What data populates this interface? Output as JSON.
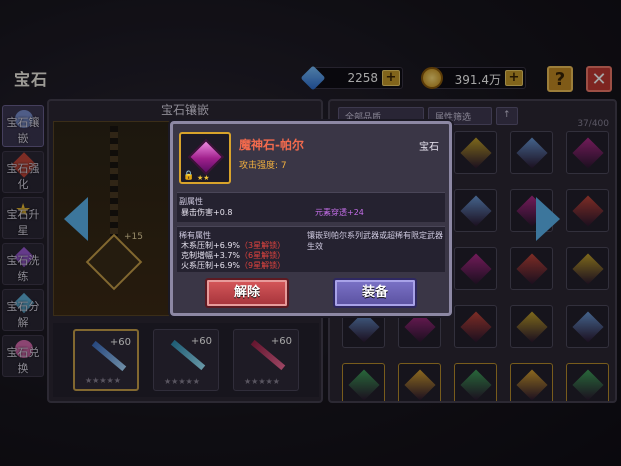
{
  "page_title": "宝石",
  "resources": {
    "diamonds": {
      "value": "2258",
      "icon": "diamond-icon",
      "color": "#3e8be6"
    },
    "gold": {
      "value": "391.4万",
      "icon": "gold-coin-icon",
      "color": "#e6b434"
    }
  },
  "top_buttons": {
    "help": "?",
    "close": "✕"
  },
  "tabs": [
    {
      "label": "宝石镶嵌",
      "active": true
    },
    {
      "label": "宝石强化",
      "active": false
    },
    {
      "label": "宝石升星",
      "active": false
    },
    {
      "label": "宝石洗练",
      "active": false
    },
    {
      "label": "宝石分解",
      "active": false
    },
    {
      "label": "宝石兑换",
      "active": false
    }
  ],
  "left_panel": {
    "header": "宝石镶嵌",
    "forge_level": "+15",
    "slots": [
      {
        "level": "+60",
        "selected": true
      },
      {
        "level": "+60",
        "selected": false
      },
      {
        "level": "+60",
        "selected": false
      }
    ]
  },
  "right_panel": {
    "filters": [
      "全部品质",
      "属性筛选",
      "↑"
    ],
    "capacity": "37/400"
  },
  "modal": {
    "name": "魔神石-帕尔",
    "type": "宝石",
    "attack_label": "攻击强度: 7",
    "secondary": {
      "heading": "副属性",
      "crit": "暴击伤害+0.8",
      "element": "元素穿透+24"
    },
    "rare": {
      "heading": "稀有属性",
      "note": "镶嵌到帕尔系列武器或超稀有限定武器生效",
      "rows": [
        {
          "text": "木系压制+6.9%",
          "lock": "（3星解锁）"
        },
        {
          "text": "克制增幅+3.7%",
          "lock": "（6星解锁）"
        },
        {
          "text": "火系压制+6.9%",
          "lock": "（9星解锁）"
        }
      ]
    },
    "buttons": {
      "remove": "解除",
      "equip": "装备"
    }
  },
  "colors": {
    "accent_gold": "#d8a32b",
    "rare_red": "#e0433e",
    "element_purple": "#c46ee8"
  }
}
